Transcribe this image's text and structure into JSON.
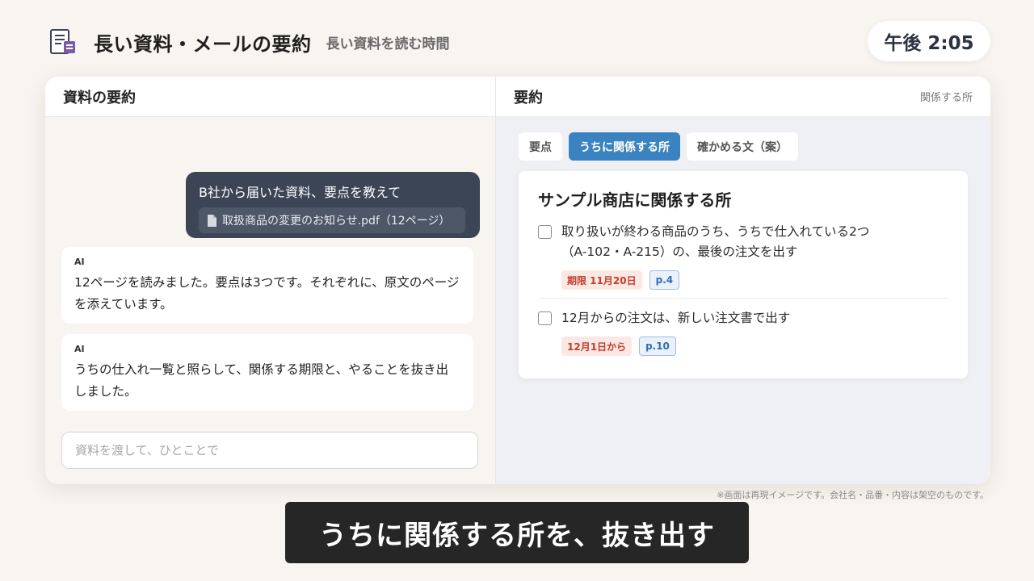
{
  "app": {
    "title": "長い資料・メールの要約",
    "subtitle": "長い資料を読む時間",
    "clock": "午後 2:05",
    "icon": "document-icon"
  },
  "left_panel": {
    "title": "資料の要約",
    "user_message": "B社から届いた資料、要点を教えて",
    "attachment": "取扱商品の変更のお知らせ.pdf（12ページ）",
    "ai_messages": [
      {
        "label": "AI",
        "text": "12ページを読みました。要点は3つです。それぞれに、原文のページを添えています。"
      },
      {
        "label": "AI",
        "text": "うちの仕入れ一覧と照らして、関係する期限と、やることを抜き出しました。"
      }
    ],
    "input_placeholder": "資料を渡して、ひとことで"
  },
  "right_panel": {
    "title": "要約",
    "side_link": "関係する所",
    "tabs": [
      {
        "label": "要点",
        "active": false
      },
      {
        "label": "うちに関係する所",
        "active": true
      },
      {
        "label": "確かめる文（案）",
        "active": false
      }
    ],
    "card_title": "サンプル商店に関係する所",
    "items": [
      {
        "text_line1": "取り扱いが終わる商品のうち、うちで仕入れている2つ",
        "text_line2": "（A-102・A-215）の、最後の注文を出す",
        "deadline": "期限 11月20日",
        "page": "p.4",
        "checked": false
      },
      {
        "text_line1": "12月からの注文は、新しい注文書で出す",
        "deadline": "12月1日から",
        "page": "p.10",
        "checked": false
      }
    ]
  },
  "disclaimer": "※画面は再現イメージです。会社名・品番・内容は架空のものです。",
  "caption": "うちに関係する所を、抜き出す",
  "colors": {
    "background": "#f8f4ef",
    "user_bubble": "#3b4556",
    "active_tab": "#3b82c0",
    "deadline_text": "#c23d2a",
    "page_badge": "#2e6db4"
  }
}
